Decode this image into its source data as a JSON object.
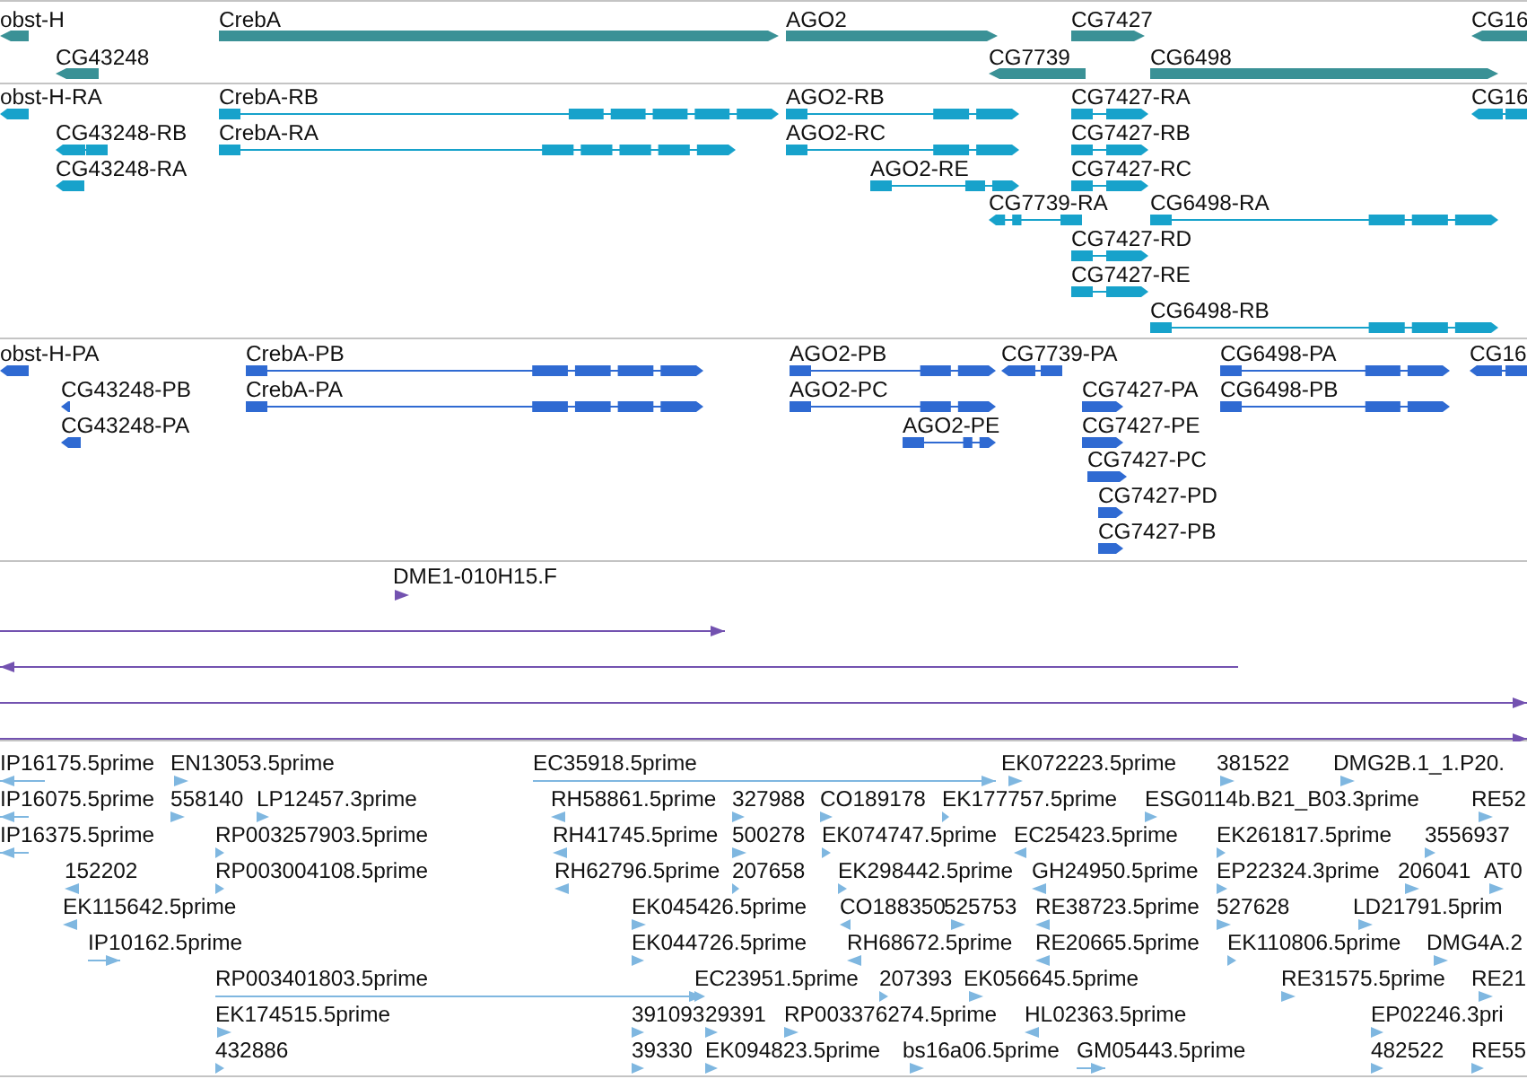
{
  "tracks": [
    {
      "kind": "gene",
      "features": [
        {
          "label": "obst-H",
          "reverse": true
        },
        {
          "label": "CG43248",
          "reverse": true
        },
        {
          "label": "CrebA",
          "reverse": false
        },
        {
          "label": "AGO2",
          "reverse": false
        },
        {
          "label": "CG7739",
          "reverse": true
        },
        {
          "label": "CG7427",
          "reverse": false
        },
        {
          "label": "CG6498",
          "reverse": false
        },
        {
          "label": "CG16",
          "reverse": true
        }
      ]
    },
    {
      "kind": "transcript",
      "features": [
        {
          "label": "obst-H-RA",
          "reverse": true
        },
        {
          "label": "CG43248-RB",
          "reverse": true
        },
        {
          "label": "CG43248-RA",
          "reverse": true
        },
        {
          "label": "CrebA-RB",
          "reverse": false
        },
        {
          "label": "CrebA-RA",
          "reverse": false
        },
        {
          "label": "AGO2-RB",
          "reverse": false
        },
        {
          "label": "AGO2-RC",
          "reverse": false
        },
        {
          "label": "AGO2-RE",
          "reverse": false
        },
        {
          "label": "CG7739-RA",
          "reverse": true
        },
        {
          "label": "CG7427-RA",
          "reverse": false
        },
        {
          "label": "CG7427-RB",
          "reverse": false
        },
        {
          "label": "CG7427-RC",
          "reverse": false
        },
        {
          "label": "CG6498-RA",
          "reverse": false
        },
        {
          "label": "CG7427-RD",
          "reverse": false
        },
        {
          "label": "CG7427-RE",
          "reverse": false
        },
        {
          "label": "CG6498-RB",
          "reverse": false
        },
        {
          "label": "CG16",
          "reverse": true
        }
      ]
    },
    {
      "kind": "transcript",
      "features": [
        {
          "label": "obst-H-PA",
          "reverse": true
        },
        {
          "label": "CG43248-PB",
          "reverse": true
        },
        {
          "label": "CG43248-PA",
          "reverse": true
        },
        {
          "label": "CrebA-PB",
          "reverse": false
        },
        {
          "label": "CrebA-PA",
          "reverse": false
        },
        {
          "label": "AGO2-PB",
          "reverse": false
        },
        {
          "label": "AGO2-PC",
          "reverse": false
        },
        {
          "label": "AGO2-PE",
          "reverse": false
        },
        {
          "label": "CG7739-PA",
          "reverse": true
        },
        {
          "label": "CG6498-PA",
          "reverse": false
        },
        {
          "label": "CG7427-PA",
          "reverse": false
        },
        {
          "label": "CG6498-PB",
          "reverse": false
        },
        {
          "label": "CG7427-PE",
          "reverse": false
        },
        {
          "label": "CG7427-PC",
          "reverse": false
        },
        {
          "label": "CG7427-PD",
          "reverse": false
        },
        {
          "label": "CG7427-PB",
          "reverse": false
        },
        {
          "label": "CG16",
          "reverse": true
        }
      ]
    },
    {
      "kind": "clone",
      "features": [
        {
          "label": "DME1-010H15.F",
          "reverse": false
        },
        {
          "reverse": false
        },
        {
          "reverse": true
        },
        {
          "reverse": false
        },
        {
          "reverse": false
        }
      ]
    },
    {
      "kind": "read",
      "features": [
        {
          "label": "IP16175.5prime",
          "reverse": true
        },
        {
          "label": "EN13053.5prime",
          "reverse": false
        },
        {
          "label": "EC35918.5prime",
          "reverse": false
        },
        {
          "label": "EK072223.5prime",
          "reverse": false
        },
        {
          "label": "381522",
          "reverse": false
        },
        {
          "label": "DMG2B.1_1.P20.",
          "reverse": false
        },
        {
          "label": "IP16075.5prime",
          "reverse": true
        },
        {
          "label": "558140",
          "reverse": false
        },
        {
          "label": "LP12457.3prime",
          "reverse": false
        },
        {
          "label": "RH58861.5prime",
          "reverse": true
        },
        {
          "label": "327988",
          "reverse": false
        },
        {
          "label": "CO189178",
          "reverse": false
        },
        {
          "label": "EK177757.5prime",
          "reverse": false
        },
        {
          "label": "ESG0114b.B21_B03.3prime",
          "reverse": false
        },
        {
          "label": "RE52",
          "reverse": false
        },
        {
          "label": "IP16375.5prime",
          "reverse": true
        },
        {
          "label": "RP003257903.5prime",
          "reverse": false
        },
        {
          "label": "RH41745.5prime",
          "reverse": true
        },
        {
          "label": "500278",
          "reverse": false
        },
        {
          "label": "EK074747.5prime",
          "reverse": false
        },
        {
          "label": "EC25423.5prime",
          "reverse": true
        },
        {
          "label": "EK261817.5prime",
          "reverse": false
        },
        {
          "label": "3556937",
          "reverse": false
        },
        {
          "label": "152202",
          "reverse": true
        },
        {
          "label": "RP003004108.5prime",
          "reverse": false
        },
        {
          "label": "RH62796.5prime",
          "reverse": true
        },
        {
          "label": "207658",
          "reverse": false
        },
        {
          "label": "EK298442.5prime",
          "reverse": false
        },
        {
          "label": "GH24950.5prime",
          "reverse": true
        },
        {
          "label": "EP22324.3prime",
          "reverse": false
        },
        {
          "label": "206041",
          "reverse": false
        },
        {
          "label": "AT0",
          "reverse": false
        },
        {
          "label": "EK115642.5prime",
          "reverse": true
        },
        {
          "label": "EK045426.5prime",
          "reverse": false
        },
        {
          "label": "CO188350",
          "reverse": true
        },
        {
          "label": "525753",
          "reverse": false
        },
        {
          "label": "RE38723.5prime",
          "reverse": true
        },
        {
          "label": "527628",
          "reverse": false
        },
        {
          "label": "LD21791.5prim",
          "reverse": false
        },
        {
          "label": "IP10162.5prime",
          "reverse": false
        },
        {
          "label": "EK044726.5prime",
          "reverse": false
        },
        {
          "label": "RH68672.5prime",
          "reverse": true
        },
        {
          "label": "RE20665.5prime",
          "reverse": true
        },
        {
          "label": "EK110806.5prime",
          "reverse": false
        },
        {
          "label": "DMG4A.2",
          "reverse": false
        },
        {
          "label": "RP003401803.5prime",
          "reverse": false
        },
        {
          "label": "EC23951.5prime",
          "reverse": false
        },
        {
          "label": "207393",
          "reverse": false
        },
        {
          "label": "EK056645.5prime",
          "reverse": false
        },
        {
          "label": "RE31575.5prime",
          "reverse": false
        },
        {
          "label": "RE21",
          "reverse": false
        },
        {
          "label": "EK174515.5prime",
          "reverse": false
        },
        {
          "label": "391093",
          "reverse": false
        },
        {
          "label": "29391",
          "reverse": false
        },
        {
          "label": "RP003376274.5prime",
          "reverse": false
        },
        {
          "label": "HL02363.5prime",
          "reverse": true
        },
        {
          "label": "EP02246.3pri",
          "reverse": false
        },
        {
          "label": "432886",
          "reverse": false
        },
        {
          "label": "39330",
          "reverse": false
        },
        {
          "label": "EK094823.5prime",
          "reverse": false
        },
        {
          "label": "bs16a06.5prime",
          "reverse": false
        },
        {
          "label": "GM05443.5prime",
          "reverse": false
        },
        {
          "label": "482522",
          "reverse": false
        },
        {
          "label": "RE55",
          "reverse": false
        }
      ]
    }
  ]
}
